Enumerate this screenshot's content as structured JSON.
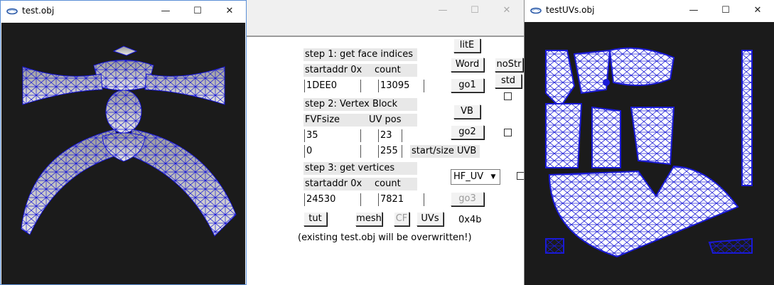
{
  "left_window": {
    "title": "test.obj",
    "minimize_glyph": "—",
    "maximize_glyph": "☐",
    "close_glyph": "✕",
    "viewport_bg": "#1b1b1b",
    "mesh_color": "#1a1ad6"
  },
  "center_window": {
    "minimize_glyph": "—",
    "maximize_glyph": "☐",
    "close_glyph": "✕",
    "step1": {
      "heading": "step 1: get face indices",
      "startaddr_label": "startaddr 0x",
      "count_label": "count",
      "startaddr_value": "1DEE0",
      "count_value": "13095"
    },
    "step2": {
      "heading": "step 2: Vertex Block",
      "fvfsize_label": "FVFsize",
      "uvpos_label": "UV pos",
      "fvfsize_value": "35",
      "uvpos_value": "23",
      "uvb_start_value": "0",
      "uvb_size_value": "255",
      "uvb_label": "start/size UVB"
    },
    "step3": {
      "heading": "step 3: get vertices",
      "startaddr_label": "startaddr 0x",
      "count_label": "count",
      "startaddr_value": "24530",
      "count_value": "7821"
    },
    "buttons": {
      "lite": "litE",
      "word": "Word",
      "nostr": "noStr",
      "std": "std",
      "go1": "go1",
      "vb": "VB",
      "go2": "go2",
      "go3": "go3",
      "tut": "tut",
      "mesh": "mesh",
      "cf": "CF",
      "uvs": "UVs"
    },
    "format_select": "HF_UV",
    "hex_readout": "0x4b",
    "warning": "(existing test.obj will be overwritten!)"
  },
  "right_window": {
    "title": "testUVs.obj",
    "minimize_glyph": "—",
    "maximize_glyph": "☐",
    "close_glyph": "✕",
    "viewport_bg": "#1b1b1b",
    "mesh_color": "#1a1ad6"
  }
}
